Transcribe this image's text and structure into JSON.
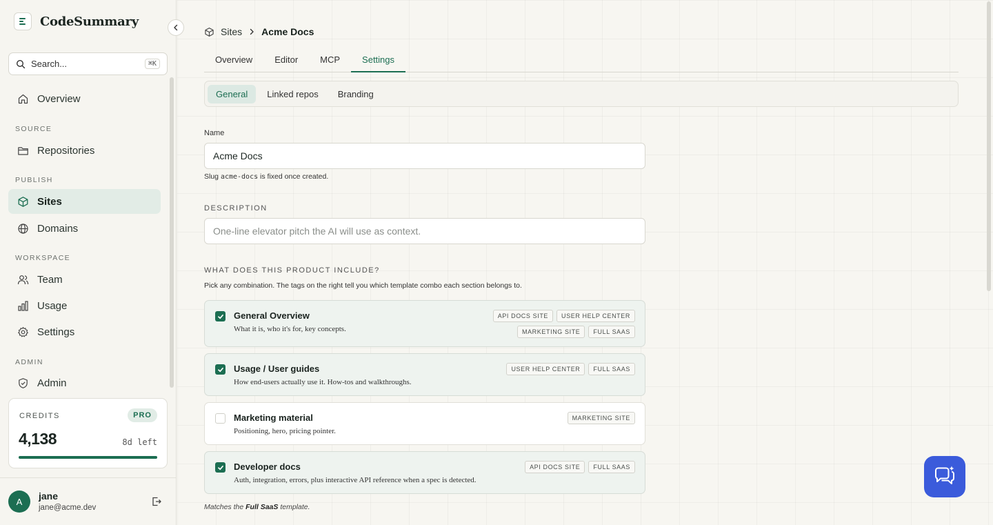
{
  "app": {
    "name": "CodeSummary"
  },
  "search": {
    "placeholder": "Search...",
    "shortcut": "⌘K"
  },
  "nav": {
    "overview": "Overview",
    "source_heading": "SOURCE",
    "repositories": "Repositories",
    "publish_heading": "PUBLISH",
    "sites": "Sites",
    "domains": "Domains",
    "workspace_heading": "WORKSPACE",
    "team": "Team",
    "usage": "Usage",
    "settings": "Settings",
    "admin_heading": "ADMIN",
    "admin": "Admin",
    "active_item": "Sites"
  },
  "credits": {
    "label": "CREDITS",
    "plan": "PRO",
    "value": "4,138",
    "time_left": "8d left",
    "progress": 1.0
  },
  "user": {
    "initial": "A",
    "name": "jane",
    "email": "jane@acme.dev"
  },
  "breadcrumb": {
    "parent": "Sites",
    "current": "Acme Docs"
  },
  "tabs": [
    "Overview",
    "Editor",
    "MCP",
    "Settings"
  ],
  "active_tab": "Settings",
  "subtabs": [
    "General",
    "Linked repos",
    "Branding"
  ],
  "active_subtab": "General",
  "form": {
    "name_label": "Name",
    "name_value": "Acme Docs",
    "slug_prefix": "Slug",
    "slug": "acme-docs",
    "slug_suffix": "is fixed once created.",
    "description_label": "DESCRIPTION",
    "description_placeholder": "One-line elevator pitch the AI will use as context.",
    "includes_label": "WHAT DOES THIS PRODUCT INCLUDE?",
    "includes_hint": "Pick any combination. The tags on the right tell you which template combo each section belongs to."
  },
  "sections": [
    {
      "title": "General Overview",
      "desc": "What it is, who it's for, key concepts.",
      "checked": true,
      "tags": [
        "API DOCS SITE",
        "USER HELP CENTER",
        "MARKETING SITE",
        "FULL SAAS"
      ]
    },
    {
      "title": "Usage / User guides",
      "desc": "How end-users actually use it. How-tos and walkthroughs.",
      "checked": true,
      "tags": [
        "USER HELP CENTER",
        "FULL SAAS"
      ]
    },
    {
      "title": "Marketing material",
      "desc": "Positioning, hero, pricing pointer.",
      "checked": false,
      "tags": [
        "MARKETING SITE"
      ]
    },
    {
      "title": "Developer docs",
      "desc": "Auth, integration, errors, plus interactive API reference when a spec is detected.",
      "checked": true,
      "tags": [
        "API DOCS SITE",
        "FULL SAAS"
      ]
    }
  ],
  "footnote": {
    "prefix": "Matches the",
    "template": "Full SaaS",
    "suffix": "template."
  },
  "colors": {
    "accent": "#1c6e52",
    "chat": "#3b5bdb",
    "background": "#f7f6f1"
  }
}
